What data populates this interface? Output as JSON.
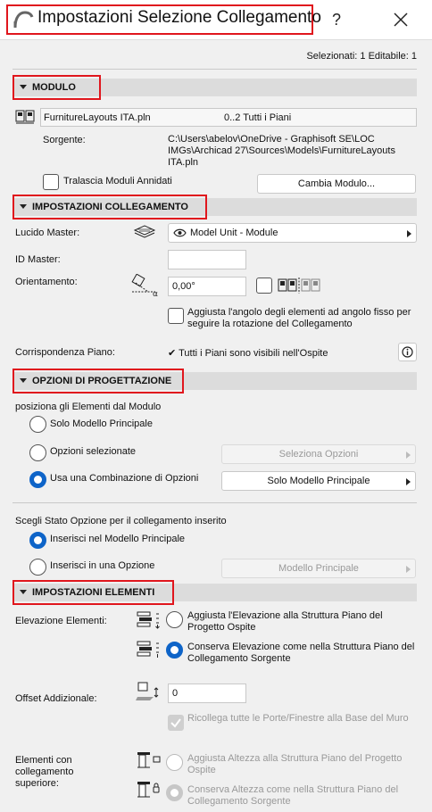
{
  "window": {
    "title": "Impostazioni Selezione Collegamento",
    "help": "?",
    "close_icon": "close-icon"
  },
  "selection_info": "Selezionati: 1 Editabile: 1",
  "modulo": {
    "header": "MODULO",
    "file_name": "FurnitureLayouts ITA.pln",
    "floors": "0..2 Tutti i Piani",
    "source_label": "Sorgente:",
    "source_path": "C:\\Users\\abelov\\OneDrive - Graphisoft SE\\LOC IMGs\\Archicad 27\\Sources\\Models\\FurnitureLayouts ITA.pln",
    "skip_nested_label": "Tralascia Moduli Annidati",
    "change_module_button": "Cambia Modulo..."
  },
  "link_settings": {
    "header": "IMPOSTAZIONI COLLEGAMENTO",
    "master_layer_label": "Lucido Master:",
    "master_layer_value": "Model Unit - Module",
    "master_id_label": "ID Master:",
    "master_id_value": "",
    "orientation_label": "Orientamento:",
    "orientation_value": "0,00°",
    "adjust_angle_label": "Aggiusta l'angolo degli elementi ad angolo fisso per seguire la rotazione del Collegamento",
    "floor_match_label": "Corrispondenza Piano:",
    "floor_match_value": "Tutti i Piani sono visibili nell'Ospite"
  },
  "design_options": {
    "header": "OPZIONI DI PROGETTAZIONE",
    "position_label": "posiziona gli Elementi dal Modulo",
    "opt_main_model": "Solo Modello Principale",
    "opt_selected": "Opzioni selezionate",
    "select_options_button": "Seleziona Opzioni",
    "opt_combination": "Usa una Combinazione di Opzioni",
    "combination_value": "Solo Modello Principale",
    "state_label": "Scegli Stato Opzione per il collegamento inserito",
    "insert_main": "Inserisci nel Modello Principale",
    "insert_option": "Inserisci in una Opzione",
    "insert_option_value": "Modello Principale"
  },
  "element_settings": {
    "header": "IMPOSTAZIONI ELEMENTI",
    "elevation_label": "Elevazione Elementi:",
    "elev_adjust": "Aggiusta l'Elevazione alla Struttura Piano del Progetto Ospite",
    "elev_keep": "Conserva Elevazione come nella Struttura Piano del Collegamento Sorgente",
    "offset_label": "Offset Addizionale:",
    "offset_value": "0",
    "reconnect_doors": "Ricollega tutte le Porte/Finestre alla Base del Muro",
    "top_linked_label": "Elementi con collegamento superiore:",
    "height_adjust": "Aggiusta Altezza alla Struttura Piano del Progetto Ospite",
    "height_keep": "Conserva Altezza come nella Struttura Piano del Collegamento Sorgente"
  },
  "colors": {
    "highlight": "#e0161d",
    "accent": "#0e64c8",
    "section_bg": "#dcdcdc"
  }
}
